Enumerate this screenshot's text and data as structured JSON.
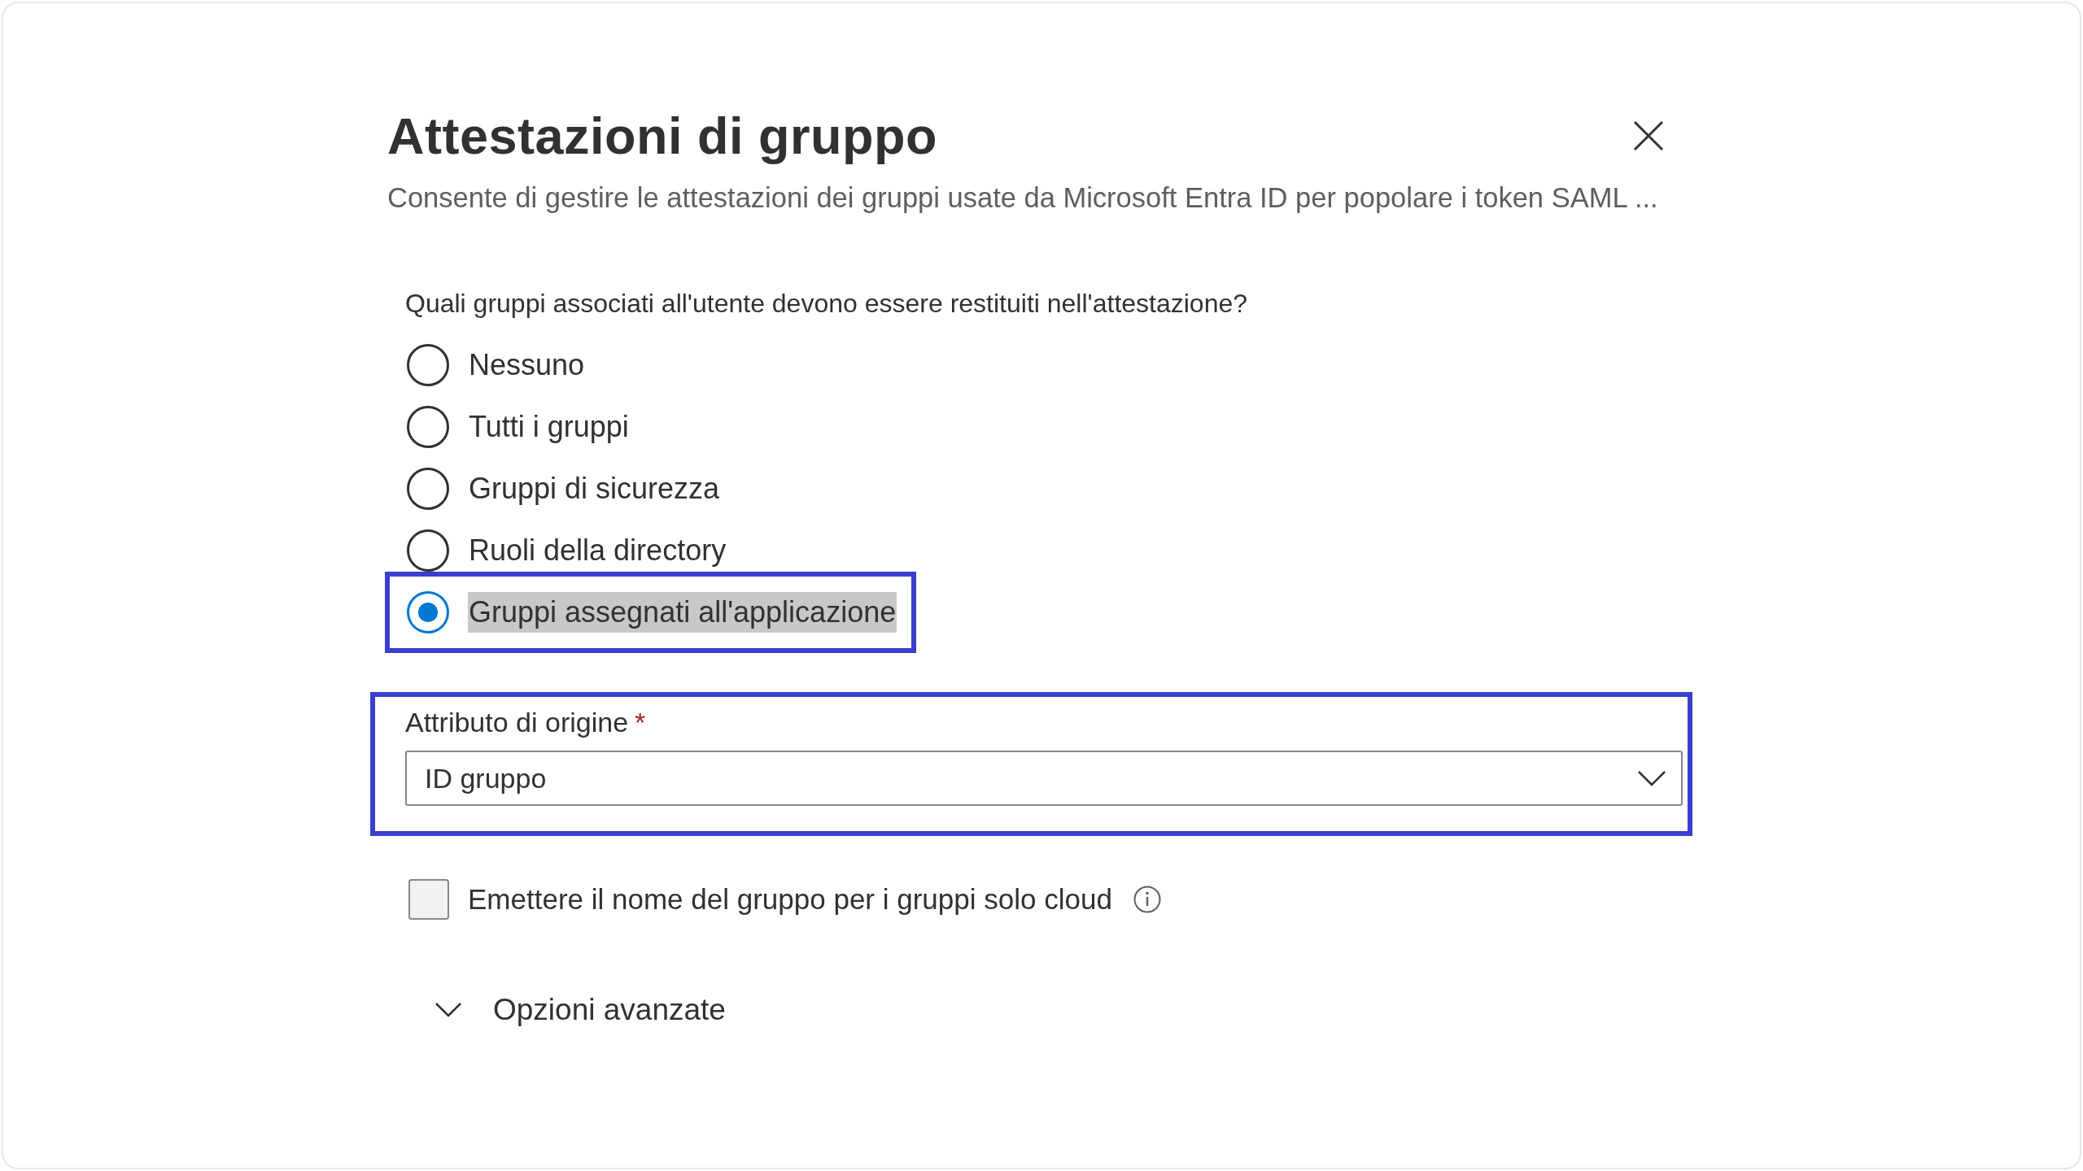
{
  "panel": {
    "title": "Attestazioni di gruppo",
    "description": "Consente di gestire le attestazioni dei gruppi usate da Microsoft Entra ID per popolare i token SAML ..."
  },
  "question": "Quali gruppi associati all'utente devono essere restituiti nell'attestazione?",
  "options": [
    {
      "label": "Nessuno",
      "selected": false,
      "highlighted": false,
      "text_selected": false
    },
    {
      "label": "Tutti i gruppi",
      "selected": false,
      "highlighted": false,
      "text_selected": false
    },
    {
      "label": "Gruppi di sicurezza",
      "selected": false,
      "highlighted": false,
      "text_selected": false
    },
    {
      "label": "Ruoli della directory",
      "selected": false,
      "highlighted": false,
      "text_selected": false
    },
    {
      "label": "Gruppi assegnati all'applicazione",
      "selected": true,
      "highlighted": true,
      "text_selected": true
    }
  ],
  "source_attribute": {
    "label": "Attributo di origine",
    "required": true,
    "required_mark": "*",
    "value": "ID gruppo",
    "highlighted": true
  },
  "cloud_only_checkbox": {
    "label": "Emettere il nome del gruppo per i gruppi solo cloud",
    "checked": false
  },
  "advanced_options": {
    "label": "Opzioni avanzate",
    "expanded": false
  }
}
